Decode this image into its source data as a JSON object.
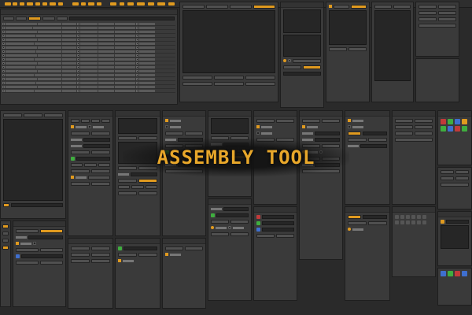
{
  "title": "ASSEMBLY TOOL",
  "colors": {
    "accent": "#e09a1f",
    "panel": "#3a3a3a",
    "background": "#2a2a2a",
    "green": "#3fae3f",
    "blue": "#3f6fcf",
    "red": "#c23a3a"
  },
  "icons": [
    "checkbox-icon",
    "radio-icon",
    "color-swatch-icon"
  ]
}
